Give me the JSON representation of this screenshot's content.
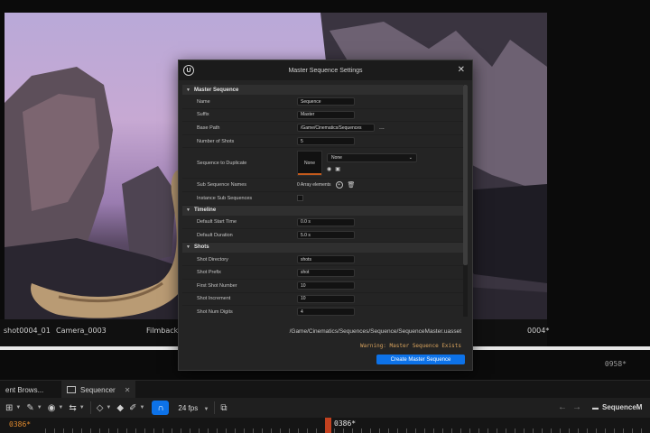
{
  "viewport": {
    "shot_name": "shot0004_01",
    "camera": "Camera_0003",
    "filmback": "Filmback",
    "frame_current": "0004*",
    "frame_end": "0958*"
  },
  "dialog": {
    "title": "Master Sequence Settings",
    "logo_letter": "U",
    "close": "✕",
    "sections": {
      "master": "Master Sequence",
      "timeline": "Timeline",
      "shots": "Shots"
    },
    "fields": {
      "name": {
        "label": "Name",
        "value": "Sequence"
      },
      "suffix": {
        "label": "Suffix",
        "value": "Master"
      },
      "base_path": {
        "label": "Base Path",
        "value": "/Game/Cinematics/Sequences",
        "browse": "..."
      },
      "number_of_shots": {
        "label": "Number of Shots",
        "value": "5"
      },
      "sequence_to_duplicate": {
        "label": "Sequence to Duplicate",
        "thumb": "None",
        "combo": "None"
      },
      "sub_sequence_names": {
        "label": "Sub Sequence Names",
        "value": "0 Array elements"
      },
      "instance_sub_sequences": {
        "label": "Instance Sub Sequences"
      },
      "default_start_time": {
        "label": "Default Start Time",
        "value": "0.0 s"
      },
      "default_duration": {
        "label": "Default Duration",
        "value": "5.0 s"
      },
      "shot_directory": {
        "label": "Shot Directory",
        "value": "shots"
      },
      "shot_prefix": {
        "label": "Shot Prefix",
        "value": "shot"
      },
      "first_shot_number": {
        "label": "First Shot Number",
        "value": "10"
      },
      "shot_increment": {
        "label": "Shot Increment",
        "value": "10"
      },
      "shot_num_digits": {
        "label": "Shot Num Digits",
        "value": "4"
      }
    },
    "asset_path": "/Game/Cinematics/Sequences/Sequence/SequenceMaster.uasset",
    "warning": "Warning: Master Sequence Exists",
    "create_button": "Create Master Sequence"
  },
  "editor": {
    "tabs": [
      {
        "label": "ent Brows..."
      },
      {
        "label": "Sequencer"
      }
    ],
    "fps": "24 fps",
    "breadcrumb": "SequenceM",
    "frame_left": "0386*",
    "frame_playhead": "0386*"
  },
  "colors": {
    "accent": "#0d72e8",
    "warning": "#d9a35d",
    "playhead": "#c2411f"
  }
}
